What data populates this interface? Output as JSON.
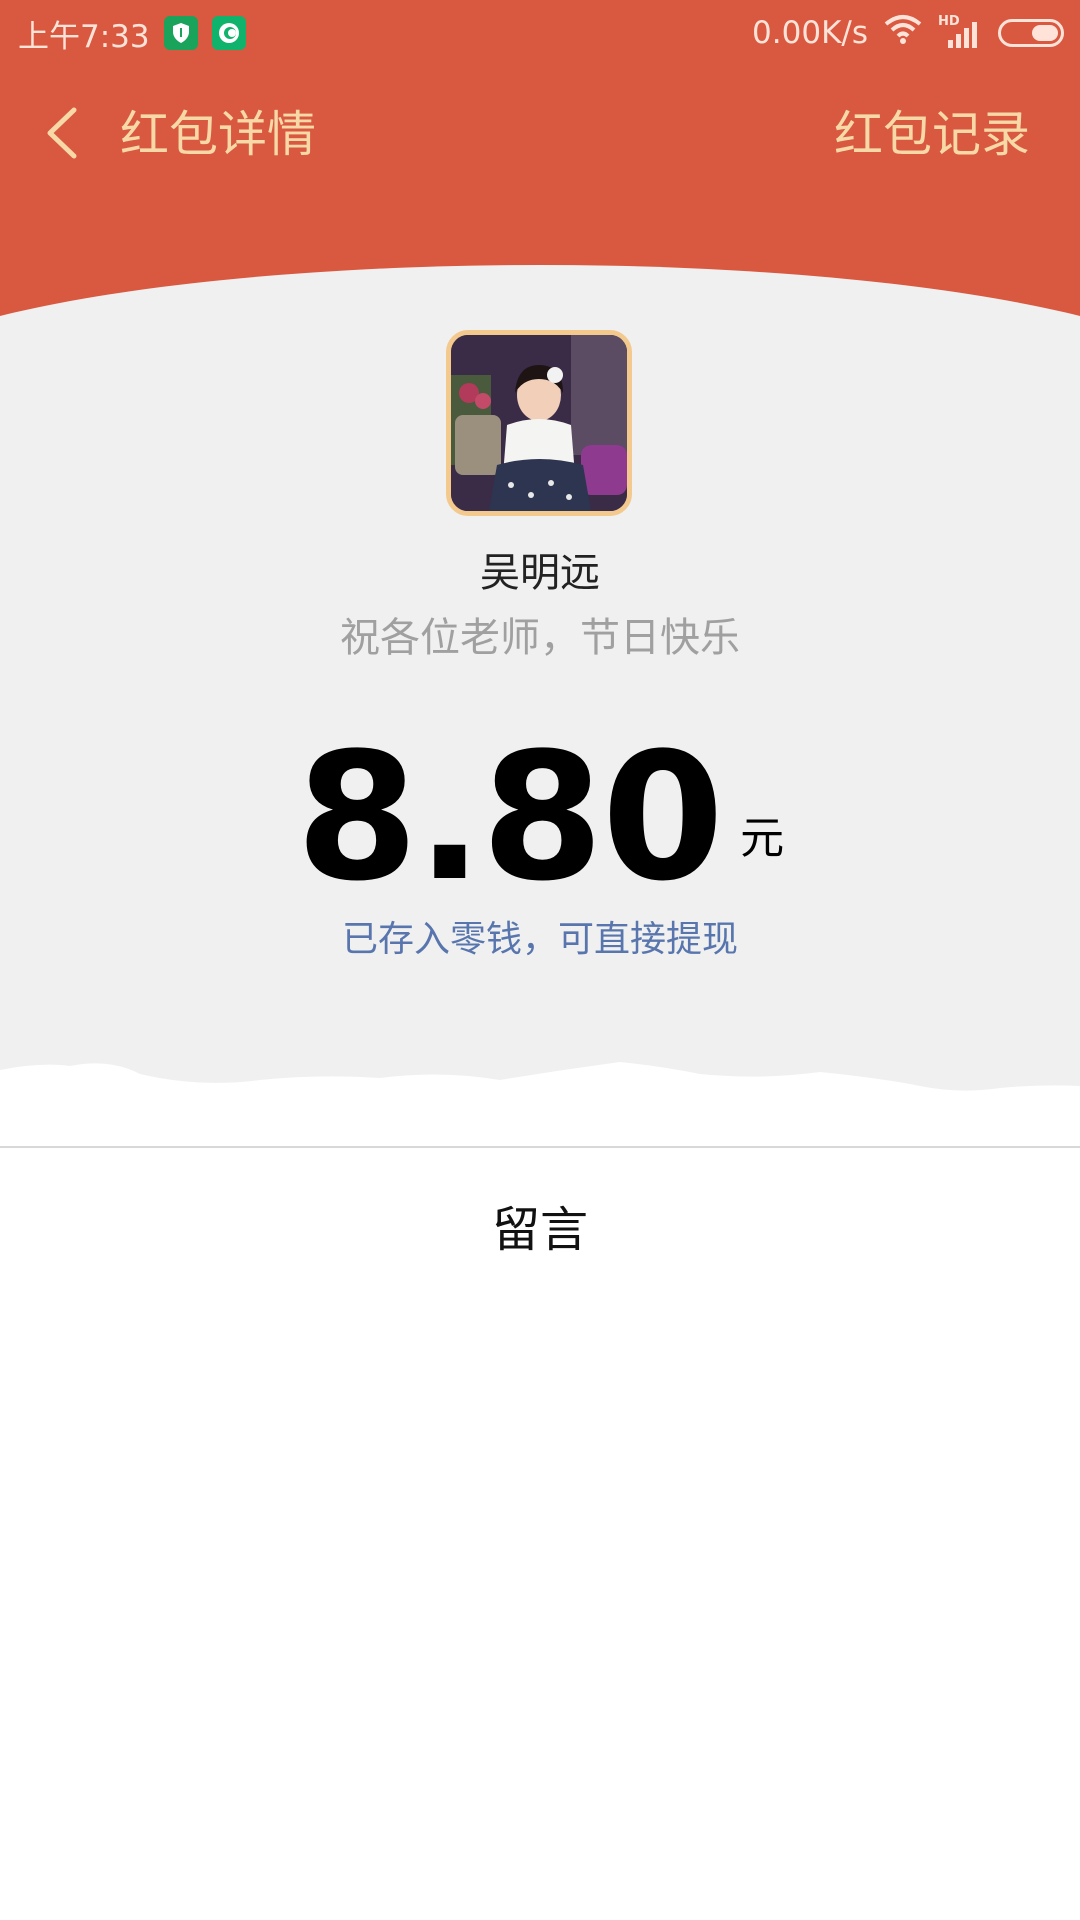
{
  "status_bar": {
    "time": "上午7:33",
    "network_speed": "0.00K/s",
    "icons": [
      "shield-app-icon",
      "chat-app-icon",
      "wifi-icon",
      "hd-signal-icon",
      "battery-icon"
    ],
    "signal_label": "HD"
  },
  "header": {
    "back_icon": "chevron-left-icon",
    "title": "红包详情",
    "records_link": "红包记录"
  },
  "sender": {
    "name": "吴明远",
    "wish": "祝各位老师，节日快乐"
  },
  "amount": {
    "value": "8.80",
    "unit": "元",
    "note": "已存入零钱，可直接提现"
  },
  "comment_label": "留言",
  "colors": {
    "header_red": "#d95940",
    "gold_text": "#f7d9a8",
    "note_blue": "#5876ad",
    "avatar_border": "#f3c98d"
  }
}
